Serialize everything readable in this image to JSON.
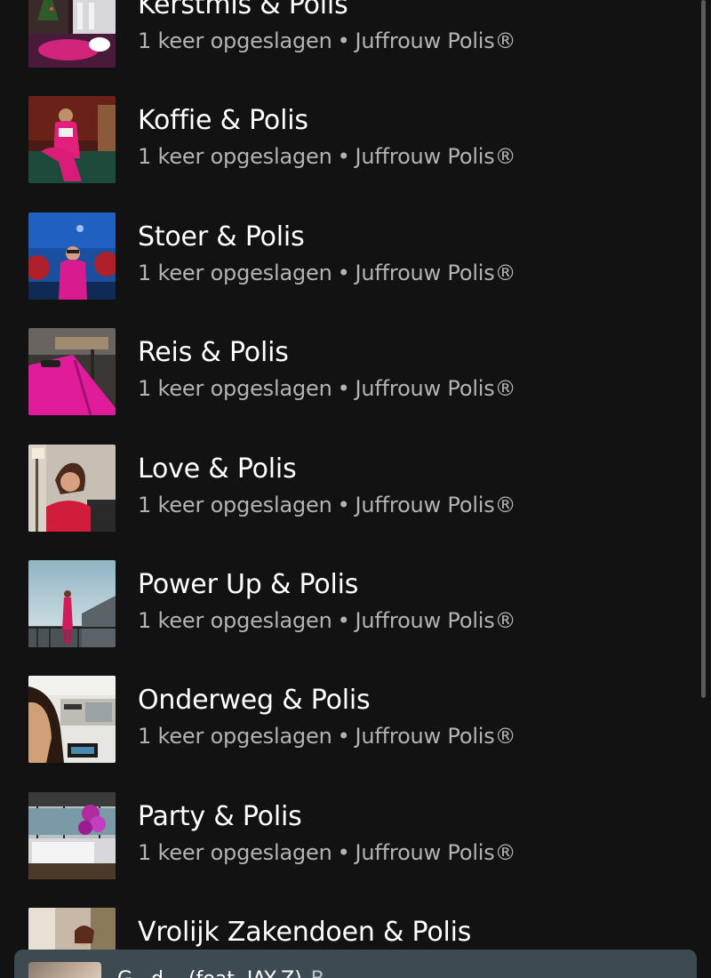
{
  "episodes": [
    {
      "title": "Kerstmis & Polis",
      "saves": "1 keer opgeslagen",
      "separator": "•",
      "show": "Juffrouw Polis®",
      "thumb_icon": "christmas-table-photo"
    },
    {
      "title": "Koffie & Polis",
      "saves": "1 keer opgeslagen",
      "separator": "•",
      "show": "Juffrouw Polis®",
      "thumb_icon": "woman-on-couch-photo"
    },
    {
      "title": "Stoer & Polis",
      "saves": "1 keer opgeslagen",
      "separator": "•",
      "show": "Juffrouw Polis®",
      "thumb_icon": "woman-blue-room-photo"
    },
    {
      "title": "Reis & Polis",
      "saves": "1 keer opgeslagen",
      "separator": "•",
      "show": "Juffrouw Polis®",
      "thumb_icon": "pink-suitcase-photo"
    },
    {
      "title": "Love & Polis",
      "saves": "1 keer opgeslagen",
      "separator": "•",
      "show": "Juffrouw Polis®",
      "thumb_icon": "woman-portrait-photo"
    },
    {
      "title": "Power Up & Polis",
      "saves": "1 keer opgeslagen",
      "separator": "•",
      "show": "Juffrouw Polis®",
      "thumb_icon": "woman-balcony-photo"
    },
    {
      "title": "Onderweg & Polis",
      "saves": "1 keer opgeslagen",
      "separator": "•",
      "show": "Juffrouw Polis®",
      "thumb_icon": "car-interior-photo"
    },
    {
      "title": "Party & Polis",
      "saves": "1 keer opgeslagen",
      "separator": "•",
      "show": "Juffrouw Polis®",
      "thumb_icon": "party-balloons-photo"
    },
    {
      "title": "Vrolijk Zakendoen & Polis",
      "saves": "",
      "separator": "",
      "show": "",
      "thumb_icon": "woman-office-photo"
    }
  ],
  "now_playing": {
    "title": "G...d... (feat. JAY-Z)",
    "subtitle": "B..."
  },
  "colors": {
    "background": "#121212",
    "title": "#ffffff",
    "meta": "#b3b3b3",
    "mini_player": "#3e4a52"
  }
}
